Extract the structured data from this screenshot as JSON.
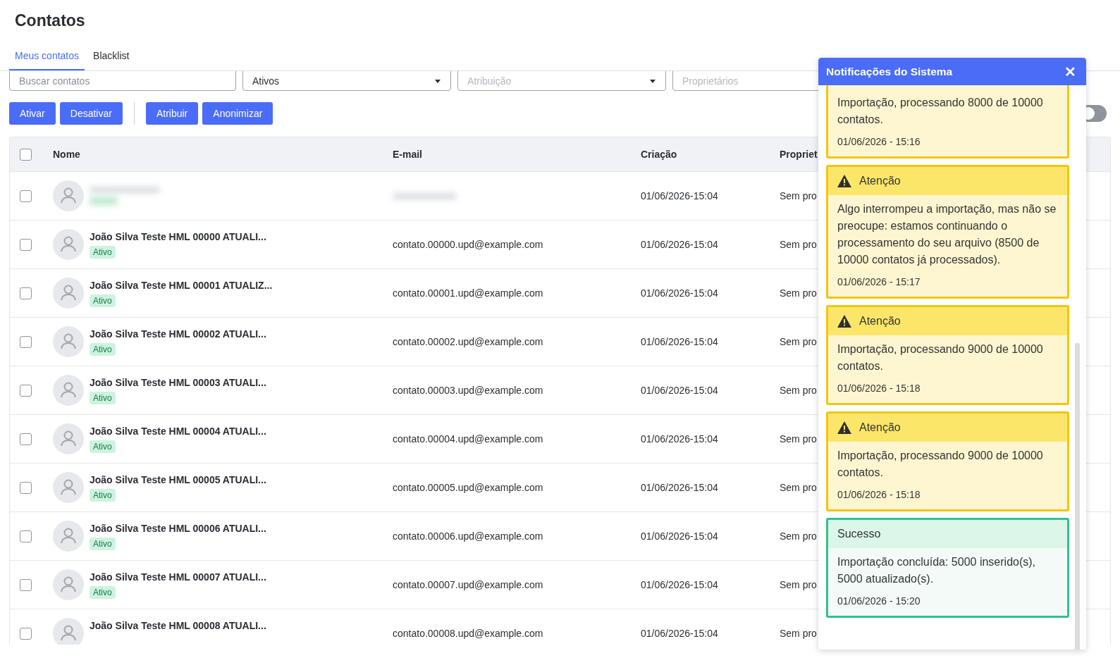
{
  "page": {
    "title": "Contatos"
  },
  "tabs": [
    {
      "label": "Meus contatos",
      "selected": true
    },
    {
      "label": "Blacklist",
      "selected": false
    }
  ],
  "filters": [
    {
      "kind": "text",
      "placeholder": "Buscar contatos"
    },
    {
      "kind": "select",
      "value": "Ativos"
    },
    {
      "kind": "select",
      "placeholder": "Atribuição"
    },
    {
      "kind": "select",
      "placeholder": "Proprietários"
    }
  ],
  "actions": [
    [
      "Ativar",
      "Desativar"
    ],
    [
      "Atribuir",
      "Anonimizar"
    ]
  ],
  "toggle": {
    "on": false
  },
  "table": {
    "columns": [
      "Nome",
      "E-mail",
      "Criação",
      "Propriet"
    ],
    "all_checked": false,
    "rows": [
      {
        "kind": "redacted",
        "checked": false,
        "created": "01/06/2026-15:04",
        "owner": "Sem pro"
      },
      {
        "kind": "contact",
        "checked": false,
        "name": "João Silva Teste HML 00000 ATUALI...",
        "status": "Ativo",
        "email": "contato.00000.upd@example.com",
        "created": "01/06/2026-15:04",
        "owner": "Sem pro"
      },
      {
        "kind": "contact",
        "checked": false,
        "name": "João Silva Teste HML 00001 ATUALIZ...",
        "status": "Ativo",
        "email": "contato.00001.upd@example.com",
        "created": "01/06/2026-15:04",
        "owner": "Sem pro"
      },
      {
        "kind": "contact",
        "checked": false,
        "name": "João Silva Teste HML 00002 ATUALI...",
        "status": "Ativo",
        "email": "contato.00002.upd@example.com",
        "created": "01/06/2026-15:04",
        "owner": "Sem pro"
      },
      {
        "kind": "contact",
        "checked": false,
        "name": "João Silva Teste HML 00003 ATUALI...",
        "status": "Ativo",
        "email": "contato.00003.upd@example.com",
        "created": "01/06/2026-15:04",
        "owner": "Sem pro"
      },
      {
        "kind": "contact",
        "checked": false,
        "name": "João Silva Teste HML 00004 ATUALI...",
        "status": "Ativo",
        "email": "contato.00004.upd@example.com",
        "created": "01/06/2026-15:04",
        "owner": "Sem pro"
      },
      {
        "kind": "contact",
        "checked": false,
        "name": "João Silva Teste HML 00005 ATUALI...",
        "status": "Ativo",
        "email": "contato.00005.upd@example.com",
        "created": "01/06/2026-15:04",
        "owner": "Sem pro"
      },
      {
        "kind": "contact",
        "checked": false,
        "name": "João Silva Teste HML 00006 ATUALI...",
        "status": "Ativo",
        "email": "contato.00006.upd@example.com",
        "created": "01/06/2026-15:04",
        "owner": "Sem pro"
      },
      {
        "kind": "contact",
        "checked": false,
        "name": "João Silva Teste HML 00007 ATUALI...",
        "status": "Ativo",
        "email": "contato.00007.upd@example.com",
        "created": "01/06/2026-15:04",
        "owner": "Sem pro"
      },
      {
        "kind": "contact",
        "checked": false,
        "name": "João Silva Teste HML 00008 ATUALI...",
        "email": "contato.00008.upd@example.com",
        "created": "01/06/2026-15:04",
        "owner": "Sem pro"
      }
    ]
  },
  "notifications": {
    "title": "Notificações do Sistema",
    "close": "✕",
    "items": [
      {
        "kind": "warning",
        "message": "Importação, processando 8000 de 10000 contatos.",
        "time": "01/06/2026 - 15:16"
      },
      {
        "kind": "warning",
        "title": "Atenção",
        "message": "Algo interrompeu a importação, mas não se preocupe: estamos continuando o processamento do seu arquivo (8500 de 10000 contatos já processados).",
        "time": "01/06/2026 - 15:17"
      },
      {
        "kind": "warning",
        "title": "Atenção",
        "message": "Importação, processando 9000 de 10000 contatos.",
        "time": "01/06/2026 - 15:18"
      },
      {
        "kind": "warning",
        "title": "Atenção",
        "message": "Importação, processando 9000 de 10000 contatos.",
        "time": "01/06/2026 - 15:18"
      },
      {
        "kind": "success",
        "title": "Sucesso",
        "message": "Importação concluída: 5000 inserido(s), 5000 atualizado(s).",
        "time": "01/06/2026 - 15:20"
      }
    ]
  }
}
